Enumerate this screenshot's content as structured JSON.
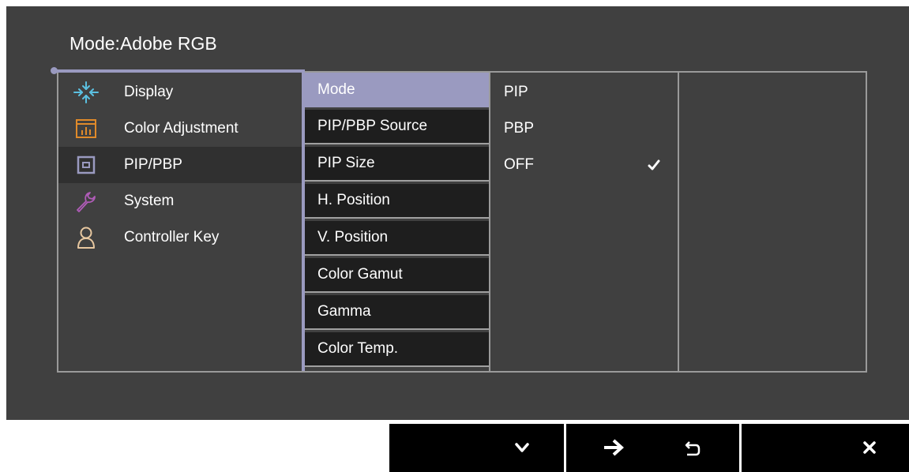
{
  "header": {
    "mode_label": "Mode:",
    "mode_value": "Adobe RGB"
  },
  "main_menu": {
    "selected_index": 2,
    "items": [
      {
        "label": "Display",
        "icon": "display-icon"
      },
      {
        "label": "Color Adjustment",
        "icon": "color-adjustment-icon"
      },
      {
        "label": "PIP/PBP",
        "icon": "pip-pbp-icon"
      },
      {
        "label": "System",
        "icon": "wrench-icon"
      },
      {
        "label": "Controller Key",
        "icon": "user-icon"
      }
    ]
  },
  "submenu": {
    "selected_index": 0,
    "items": [
      {
        "label": "Mode"
      },
      {
        "label": "PIP/PBP Source"
      },
      {
        "label": "PIP Size"
      },
      {
        "label": "H. Position"
      },
      {
        "label": "V. Position"
      },
      {
        "label": "Color Gamut"
      },
      {
        "label": "Gamma"
      },
      {
        "label": "Color Temp."
      }
    ]
  },
  "options": {
    "checked_index": 2,
    "items": [
      {
        "label": "PIP"
      },
      {
        "label": "PBP"
      },
      {
        "label": "OFF"
      }
    ]
  },
  "keys": [
    {
      "icon": "chevron-down-icon"
    },
    {
      "icon": "arrow-right-icon"
    },
    {
      "icon": "return-icon"
    },
    {
      "icon": "close-icon"
    }
  ],
  "colors": {
    "osd_background": "#404040",
    "highlight": "#9a9ac0",
    "submenu_background": "#1e1e1e",
    "display_icon": "#5bc0e0",
    "color_adjustment_icon": "#e08a2a",
    "pip_icon": "#9a9ac0",
    "system_icon": "#b05cb8",
    "controller_icon": "#e8c8a0"
  }
}
